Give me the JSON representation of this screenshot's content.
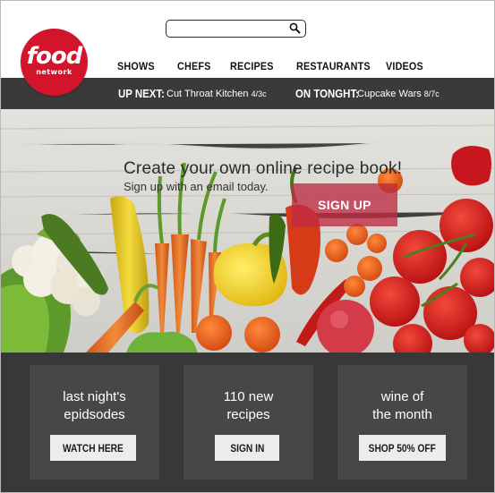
{
  "brand": {
    "logo_word": "food",
    "logo_sub": "network",
    "logo_color": "#d3152c"
  },
  "search": {
    "value": "",
    "icon": "search-icon"
  },
  "nav": {
    "items": [
      "SHOWS",
      "CHEFS",
      "RECIPES",
      "RESTAURANTS",
      "VIDEOS"
    ]
  },
  "ticker": {
    "up_next_label": "UP NEXT:",
    "up_next_show": "Cut Throat Kitchen",
    "up_next_time": "4/3c",
    "tonight_label": "ON TONGHT:",
    "tonight_show": "Cupcake Wars",
    "tonight_time": "8/7c",
    "bar_color": "#3a3a3a"
  },
  "hero": {
    "headline": "Create your own online recipe book!",
    "subtext": "Sign up with an email today.",
    "signup_label": "SIGN UP",
    "signup_color": "#be2c42"
  },
  "cards": [
    {
      "line1": "last night's",
      "line2": "epidsodes",
      "button": "WATCH HERE"
    },
    {
      "line1": "110 new",
      "line2": "recipes",
      "button": "SIGN IN"
    },
    {
      "line1": "wine of",
      "line2": "the month",
      "button": "SHOP 50% OFF"
    }
  ]
}
